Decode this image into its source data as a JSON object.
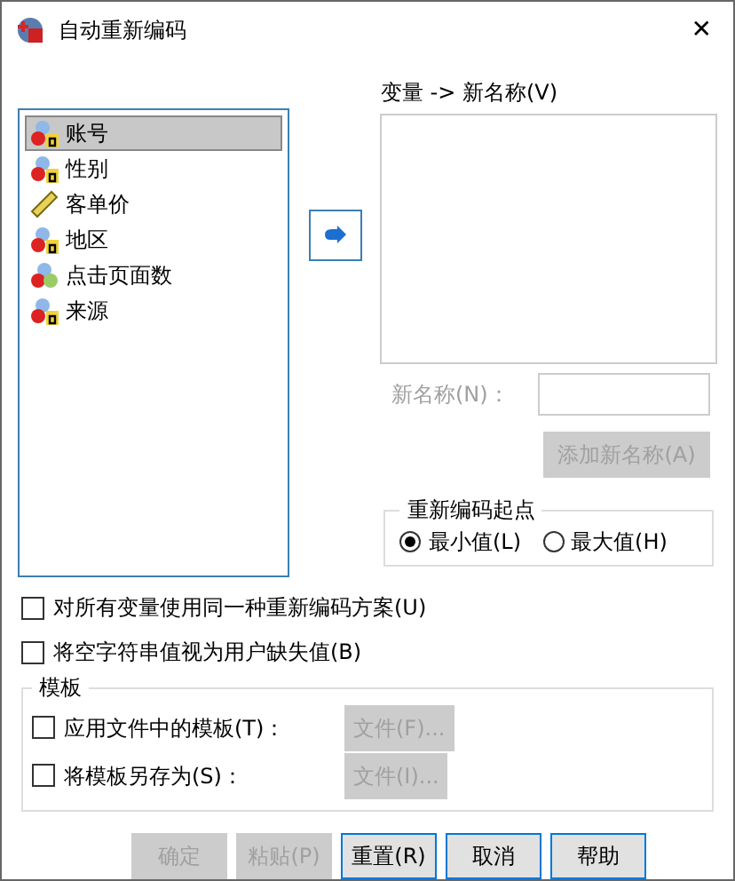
{
  "window": {
    "title": "自动重新编码",
    "close": "✕"
  },
  "variables": [
    {
      "name": "账号",
      "kind": "nominal_string",
      "selected": true
    },
    {
      "name": "性别",
      "kind": "nominal_string",
      "selected": false
    },
    {
      "name": "客单价",
      "kind": "scale",
      "selected": false
    },
    {
      "name": "地区",
      "kind": "nominal_string",
      "selected": false
    },
    {
      "name": "点击页面数",
      "kind": "nominal",
      "selected": false
    },
    {
      "name": "来源",
      "kind": "nominal_string",
      "selected": false
    }
  ],
  "target_list": {
    "label": "变量 -> 新名称(V)"
  },
  "new_name": {
    "label": "新名称(N)：",
    "disabled": true
  },
  "add_button": {
    "label": "添加新名称(A)",
    "disabled": true
  },
  "recode_start": {
    "title": "重新编码起点",
    "options": [
      {
        "label": "最小值(L)",
        "selected": true
      },
      {
        "label": "最大值(H)",
        "selected": false
      }
    ]
  },
  "options": [
    {
      "label": "对所有变量使用同一种重新编码方案(U)",
      "checked": false
    },
    {
      "label": "将空字符串值视为用户缺失值(B)",
      "checked": false
    }
  ],
  "template": {
    "title": "模板",
    "rows": [
      {
        "label": "应用文件中的模板(T)：",
        "checked": false,
        "button": "文件(F)...",
        "disabled": true
      },
      {
        "label": "将模板另存为(S)：",
        "checked": false,
        "button": "文件(I)...",
        "disabled": true
      }
    ]
  },
  "buttons": [
    {
      "label": "确定",
      "disabled": true
    },
    {
      "label": "粘贴(P)",
      "disabled": true
    },
    {
      "label": "重置(R)",
      "disabled": false
    },
    {
      "label": "取消",
      "disabled": false
    },
    {
      "label": "帮助",
      "disabled": false
    }
  ]
}
